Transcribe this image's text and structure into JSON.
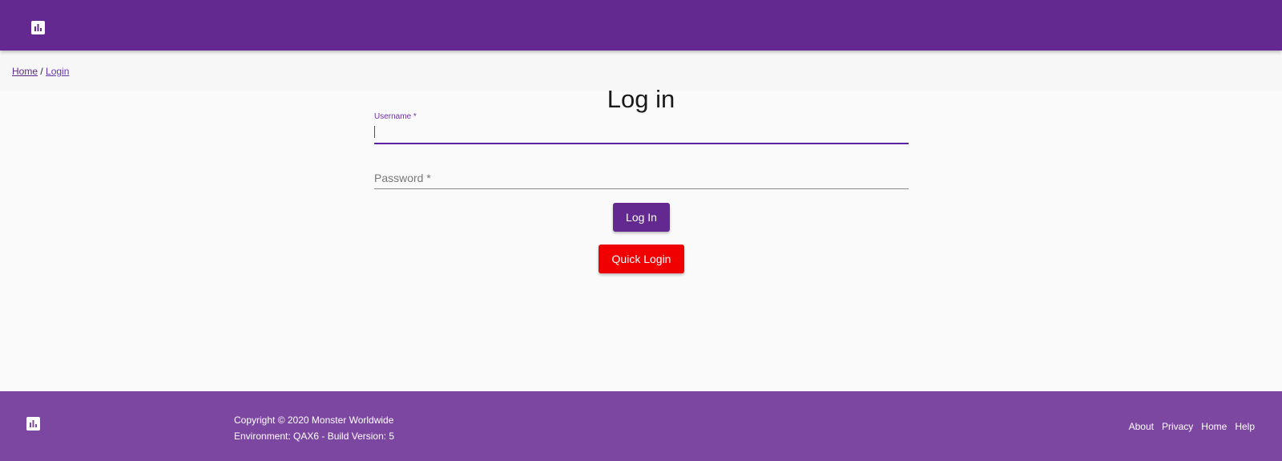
{
  "colors": {
    "header_bg": "#632990",
    "footer_bg": "#7b47a1",
    "primary_button": "#632990",
    "quick_login_button": "#f00000",
    "focus_accent": "#6a2fa8"
  },
  "header": {
    "logo_icon": "bar-chart-icon"
  },
  "breadcrumb": {
    "home": "Home",
    "separator": " / ",
    "current": "Login"
  },
  "main": {
    "title": "Log in",
    "username": {
      "label": "Username",
      "required_marker": " *",
      "value": ""
    },
    "password": {
      "placeholder": "Password *",
      "value": ""
    },
    "login_button": "Log In",
    "quick_login_button": "Quick Login"
  },
  "footer": {
    "logo_icon": "bar-chart-icon",
    "copyright": "Copyright © 2020 Monster Worldwide",
    "environment": "Environment: QAX6 - Build Version: 5",
    "links": [
      "About",
      "Privacy",
      "Home",
      "Help"
    ]
  }
}
